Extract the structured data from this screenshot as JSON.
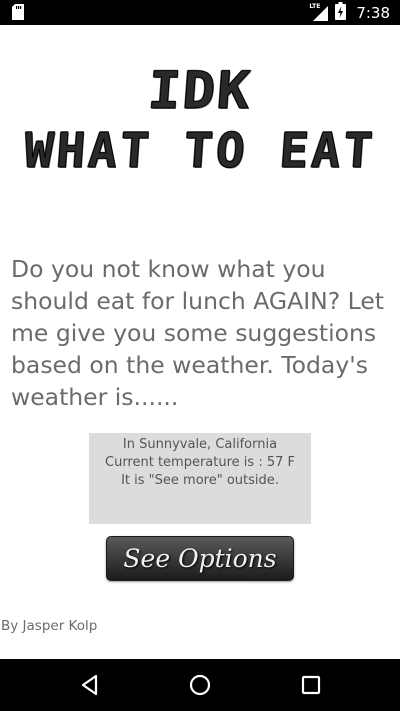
{
  "status_bar": {
    "time": "7:38",
    "network_label": "LTE",
    "icons": [
      "sd-card-icon",
      "lte-signal-icon",
      "battery-icon"
    ]
  },
  "header": {
    "title_line_1": "IDK",
    "title_line_2": "WHAT TO EAT"
  },
  "intro": {
    "text": "Do you not know what you should eat for lunch AGAIN? Let me give you some suggestions based on the weather.  Today's weather is......"
  },
  "weather": {
    "location": "In Sunnyvale, California",
    "temperature": "Current temperature is : 57 F",
    "condition": "It is \"See more\" outside."
  },
  "actions": {
    "see_options_label": "See Options"
  },
  "footer": {
    "author": "By Jasper Kolp"
  },
  "nav_bar": {
    "icons": [
      "back-icon",
      "home-icon",
      "recents-icon"
    ]
  },
  "colors": {
    "status_bar": "#000000",
    "background": "#ffffff",
    "body_text": "#6b6b6b",
    "weather_box": "#dcdcdc",
    "button": "#3a3a3a"
  }
}
